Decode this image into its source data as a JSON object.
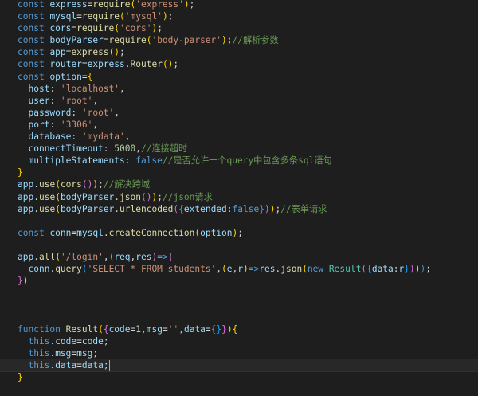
{
  "editor": {
    "theme": "dark",
    "background": "#1e1e1e",
    "cursor_line": 31
  },
  "palette": {
    "kw": "#569cd6",
    "str": "#ce9178",
    "fn": "#dcdcaa",
    "var": "#9cdcfe",
    "num": "#b5cea8",
    "cmt": "#6a9955",
    "cls": "#4ec9b0",
    "pun": "#d4d4d4",
    "p1": "#ffd700",
    "p2": "#da70d6",
    "p3": "#179fff"
  },
  "lines": [
    [
      [
        "kw",
        "const"
      ],
      [
        "pun",
        " "
      ],
      [
        "var",
        "express"
      ],
      [
        "pun",
        "="
      ],
      [
        "fn",
        "require"
      ],
      [
        "p1",
        "("
      ],
      [
        "str",
        "'express'"
      ],
      [
        "p1",
        ")"
      ],
      [
        "pun",
        ";"
      ]
    ],
    [
      [
        "kw",
        "const"
      ],
      [
        "pun",
        " "
      ],
      [
        "var",
        "mysql"
      ],
      [
        "pun",
        "="
      ],
      [
        "fn",
        "require"
      ],
      [
        "p1",
        "("
      ],
      [
        "str",
        "'mysql'"
      ],
      [
        "p1",
        ")"
      ],
      [
        "pun",
        ";"
      ]
    ],
    [
      [
        "kw",
        "const"
      ],
      [
        "pun",
        " "
      ],
      [
        "var",
        "cors"
      ],
      [
        "pun",
        "="
      ],
      [
        "fn",
        "require"
      ],
      [
        "p1",
        "("
      ],
      [
        "str",
        "'cors'"
      ],
      [
        "p1",
        ")"
      ],
      [
        "pun",
        ";"
      ]
    ],
    [
      [
        "kw",
        "const"
      ],
      [
        "pun",
        " "
      ],
      [
        "var",
        "bodyParser"
      ],
      [
        "pun",
        "="
      ],
      [
        "fn",
        "require"
      ],
      [
        "p1",
        "("
      ],
      [
        "str",
        "'body-parser'"
      ],
      [
        "p1",
        ")"
      ],
      [
        "pun",
        ";"
      ],
      [
        "cmt",
        "//解析参数"
      ]
    ],
    [
      [
        "kw",
        "const"
      ],
      [
        "pun",
        " "
      ],
      [
        "var",
        "app"
      ],
      [
        "pun",
        "="
      ],
      [
        "fn",
        "express"
      ],
      [
        "p1",
        "()"
      ],
      [
        "pun",
        ";"
      ]
    ],
    [
      [
        "kw",
        "const"
      ],
      [
        "pun",
        " "
      ],
      [
        "var",
        "router"
      ],
      [
        "pun",
        "="
      ],
      [
        "var",
        "express"
      ],
      [
        "pun",
        "."
      ],
      [
        "fn",
        "Router"
      ],
      [
        "p1",
        "()"
      ],
      [
        "pun",
        ";"
      ]
    ],
    [
      [
        "kw",
        "const"
      ],
      [
        "pun",
        " "
      ],
      [
        "var",
        "option"
      ],
      [
        "pun",
        "="
      ],
      [
        "p1",
        "{"
      ]
    ],
    [
      [
        "pun",
        "  "
      ],
      [
        "var",
        "host"
      ],
      [
        "pun",
        ": "
      ],
      [
        "str",
        "'localhost'"
      ],
      [
        "pun",
        ","
      ]
    ],
    [
      [
        "pun",
        "  "
      ],
      [
        "var",
        "user"
      ],
      [
        "pun",
        ": "
      ],
      [
        "str",
        "'root'"
      ],
      [
        "pun",
        ","
      ]
    ],
    [
      [
        "pun",
        "  "
      ],
      [
        "var",
        "password"
      ],
      [
        "pun",
        ": "
      ],
      [
        "str",
        "'root'"
      ],
      [
        "pun",
        ","
      ]
    ],
    [
      [
        "pun",
        "  "
      ],
      [
        "var",
        "port"
      ],
      [
        "pun",
        ": "
      ],
      [
        "str",
        "'3306'"
      ],
      [
        "pun",
        ","
      ]
    ],
    [
      [
        "pun",
        "  "
      ],
      [
        "var",
        "database"
      ],
      [
        "pun",
        ": "
      ],
      [
        "str",
        "'mydata'"
      ],
      [
        "pun",
        ","
      ]
    ],
    [
      [
        "pun",
        "  "
      ],
      [
        "var",
        "connectTimeout"
      ],
      [
        "pun",
        ": "
      ],
      [
        "num",
        "5000"
      ],
      [
        "pun",
        ","
      ],
      [
        "cmt",
        "//连接超时"
      ]
    ],
    [
      [
        "pun",
        "  "
      ],
      [
        "var",
        "multipleStatements"
      ],
      [
        "pun",
        ": "
      ],
      [
        "kw",
        "false"
      ],
      [
        "cmt",
        "//是否允许一个query中包含多条sql语句"
      ]
    ],
    [
      [
        "p1",
        "}"
      ]
    ],
    [
      [
        "var",
        "app"
      ],
      [
        "pun",
        "."
      ],
      [
        "fn",
        "use"
      ],
      [
        "p1",
        "("
      ],
      [
        "fn",
        "cors"
      ],
      [
        "p2",
        "()"
      ],
      [
        "p1",
        ")"
      ],
      [
        "pun",
        ";"
      ],
      [
        "cmt",
        "//解决跨域"
      ]
    ],
    [
      [
        "var",
        "app"
      ],
      [
        "pun",
        "."
      ],
      [
        "fn",
        "use"
      ],
      [
        "p1",
        "("
      ],
      [
        "var",
        "bodyParser"
      ],
      [
        "pun",
        "."
      ],
      [
        "fn",
        "json"
      ],
      [
        "p2",
        "()"
      ],
      [
        "p1",
        ")"
      ],
      [
        "pun",
        ";"
      ],
      [
        "cmt",
        "//json请求"
      ]
    ],
    [
      [
        "var",
        "app"
      ],
      [
        "pun",
        "."
      ],
      [
        "fn",
        "use"
      ],
      [
        "p1",
        "("
      ],
      [
        "var",
        "bodyParser"
      ],
      [
        "pun",
        "."
      ],
      [
        "fn",
        "urlencoded"
      ],
      [
        "p2",
        "("
      ],
      [
        "p3",
        "{"
      ],
      [
        "var",
        "extended"
      ],
      [
        "pun",
        ":"
      ],
      [
        "kw",
        "false"
      ],
      [
        "p3",
        "}"
      ],
      [
        "p2",
        ")"
      ],
      [
        "p1",
        ")"
      ],
      [
        "pun",
        ";"
      ],
      [
        "cmt",
        "//表单请求"
      ]
    ],
    [],
    [
      [
        "kw",
        "const"
      ],
      [
        "pun",
        " "
      ],
      [
        "var",
        "conn"
      ],
      [
        "pun",
        "="
      ],
      [
        "var",
        "mysql"
      ],
      [
        "pun",
        "."
      ],
      [
        "fn",
        "createConnection"
      ],
      [
        "p1",
        "("
      ],
      [
        "var",
        "option"
      ],
      [
        "p1",
        ")"
      ],
      [
        "pun",
        ";"
      ]
    ],
    [],
    [
      [
        "var",
        "app"
      ],
      [
        "pun",
        "."
      ],
      [
        "fn",
        "all"
      ],
      [
        "p1",
        "("
      ],
      [
        "str",
        "'/login'"
      ],
      [
        "pun",
        ","
      ],
      [
        "p2",
        "("
      ],
      [
        "var",
        "req"
      ],
      [
        "pun",
        ","
      ],
      [
        "var",
        "res"
      ],
      [
        "p2",
        ")"
      ],
      [
        "kw",
        "=>"
      ],
      [
        "p2",
        "{"
      ]
    ],
    [
      [
        "pun",
        "  "
      ],
      [
        "var",
        "conn"
      ],
      [
        "pun",
        "."
      ],
      [
        "fn",
        "query"
      ],
      [
        "p3",
        "("
      ],
      [
        "str",
        "'SELECT * FROM students'"
      ],
      [
        "pun",
        ","
      ],
      [
        "p1",
        "("
      ],
      [
        "var",
        "e"
      ],
      [
        "pun",
        ","
      ],
      [
        "var",
        "r"
      ],
      [
        "p1",
        ")"
      ],
      [
        "kw",
        "=>"
      ],
      [
        "var",
        "res"
      ],
      [
        "pun",
        "."
      ],
      [
        "fn",
        "json"
      ],
      [
        "p1",
        "("
      ],
      [
        "kw",
        "new"
      ],
      [
        "pun",
        " "
      ],
      [
        "cls",
        "Result"
      ],
      [
        "p2",
        "("
      ],
      [
        "p3",
        "{"
      ],
      [
        "var",
        "data"
      ],
      [
        "pun",
        ":"
      ],
      [
        "var",
        "r"
      ],
      [
        "p3",
        "}"
      ],
      [
        "p2",
        ")"
      ],
      [
        "p1",
        ")"
      ],
      [
        "p3",
        ")"
      ],
      [
        "pun",
        ";"
      ]
    ],
    [
      [
        "p2",
        "}"
      ],
      [
        "p1",
        ")"
      ]
    ],
    [],
    [],
    [],
    [
      [
        "kw",
        "function"
      ],
      [
        "pun",
        " "
      ],
      [
        "fn",
        "Result"
      ],
      [
        "p1",
        "("
      ],
      [
        "p2",
        "{"
      ],
      [
        "var",
        "code"
      ],
      [
        "pun",
        "="
      ],
      [
        "num",
        "1"
      ],
      [
        "pun",
        ","
      ],
      [
        "var",
        "msg"
      ],
      [
        "pun",
        "="
      ],
      [
        "str",
        "''"
      ],
      [
        "pun",
        ","
      ],
      [
        "var",
        "data"
      ],
      [
        "pun",
        "="
      ],
      [
        "p3",
        "{}"
      ],
      [
        "p2",
        "}"
      ],
      [
        "p1",
        ")"
      ],
      [
        "p1",
        "{"
      ]
    ],
    [
      [
        "pun",
        "  "
      ],
      [
        "kw",
        "this"
      ],
      [
        "pun",
        "."
      ],
      [
        "var",
        "code"
      ],
      [
        "pun",
        "="
      ],
      [
        "var",
        "code"
      ],
      [
        "pun",
        ";"
      ]
    ],
    [
      [
        "pun",
        "  "
      ],
      [
        "kw",
        "this"
      ],
      [
        "pun",
        "."
      ],
      [
        "var",
        "msg"
      ],
      [
        "pun",
        "="
      ],
      [
        "var",
        "msg"
      ],
      [
        "pun",
        ";"
      ]
    ],
    [
      [
        "pun",
        "  "
      ],
      [
        "kw",
        "this"
      ],
      [
        "pun",
        "."
      ],
      [
        "var",
        "data"
      ],
      [
        "pun",
        "="
      ],
      [
        "var",
        "data"
      ],
      [
        "pun",
        ";"
      ]
    ],
    [
      [
        "p1",
        "}"
      ]
    ]
  ]
}
